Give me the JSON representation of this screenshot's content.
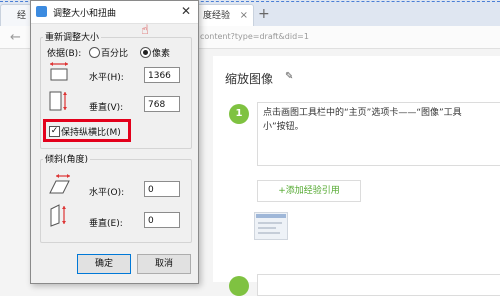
{
  "browser": {
    "tab_left_label": "经",
    "tab_active_label": "度经验",
    "tab_close": "×",
    "new_tab": "+",
    "back_arrow": "←",
    "url": "content?type=draft&did=1"
  },
  "article": {
    "title": "缩放图像",
    "edit_icon": "pencil-icon",
    "step1_number": "1",
    "step1_line1": "点击画图工具栏中的“主页”选项卡——“图像”工具",
    "step1_line2": "小”按钮。",
    "add_reference": "+添加经验引用"
  },
  "dialog": {
    "title": "调整大小和扭曲",
    "close": "✕",
    "resize_group": "重新调整大小",
    "basis_label": "依据(B):",
    "percent_label": "百分比",
    "pixel_label": "像素",
    "selected_basis": "像素",
    "horizontal_label": "水平(H):",
    "horizontal_value": "1366",
    "vertical_label": "垂直(V):",
    "vertical_value": "768",
    "keep_ratio_label": "保持纵横比(M)",
    "keep_ratio_checked": true,
    "check_mark": "✓",
    "skew_group": "倾斜(角度)",
    "skew_horizontal_label": "水平(O):",
    "skew_horizontal_value": "0",
    "skew_vertical_label": "垂直(E):",
    "skew_vertical_value": "0",
    "ok_button": "确定",
    "cancel_button": "取消",
    "highlight_color": "#e3001b",
    "cursor_icon": "hand-pointer-icon"
  }
}
